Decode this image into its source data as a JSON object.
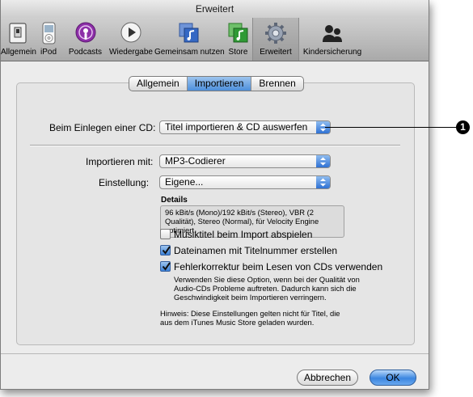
{
  "window": {
    "title": "Erweitert"
  },
  "toolbar": {
    "items": [
      {
        "label": "Allgemein",
        "icon": "switch-icon"
      },
      {
        "label": "iPod",
        "icon": "ipod-icon"
      },
      {
        "label": "Podcasts",
        "icon": "podcast-icon"
      },
      {
        "label": "Wiedergabe",
        "icon": "play-icon"
      },
      {
        "label": "Gemeinsam nutzen",
        "icon": "shared-music-icon"
      },
      {
        "label": "Store",
        "icon": "store-icon"
      },
      {
        "label": "Erweitert",
        "icon": "gear-icon",
        "selected": true
      },
      {
        "label": "Kindersicherung",
        "icon": "parental-icon"
      }
    ]
  },
  "tabs": [
    {
      "label": "Allgemein",
      "active": false
    },
    {
      "label": "Importieren",
      "active": true
    },
    {
      "label": "Brennen",
      "active": false
    }
  ],
  "cd_insert": {
    "label": "Beim Einlegen einer CD:",
    "value": "Titel importieren & CD auswerfen"
  },
  "import_with": {
    "label": "Importieren mit:",
    "value": "MP3-Codierer"
  },
  "setting": {
    "label": "Einstellung:",
    "value": "Eigene..."
  },
  "details": {
    "title": "Details",
    "lines": [
      "96 kBit/s (Mono)/192 kBit/s (Stereo), VBR (2",
      "Qualität), Stereo (Normal), für Velocity Engine",
      "optimiert."
    ]
  },
  "checkboxes": [
    {
      "label": "Musiktitel beim Import abspielen",
      "checked": false
    },
    {
      "label": "Dateinamen mit Titelnummer erstellen",
      "checked": true
    },
    {
      "label": "Fehlerkorrektur beim Lesen von CDs verwenden",
      "checked": true
    }
  ],
  "error_help": [
    "Verwenden Sie diese Option, wenn bei der Qualität von",
    "Audio-CDs Probleme auftreten. Dadurch kann sich die",
    "Geschwindigkeit beim Importieren verringern."
  ],
  "hint": [
    "Hinweis: Diese Einstellungen gelten nicht für Titel, die",
    "aus dem iTunes Music Store geladen wurden."
  ],
  "buttons": {
    "cancel": "Abbrechen",
    "ok": "OK"
  },
  "callout": {
    "number": "1"
  },
  "colors": {
    "accent": "#3b86e0",
    "window_bg": "#ececec"
  }
}
